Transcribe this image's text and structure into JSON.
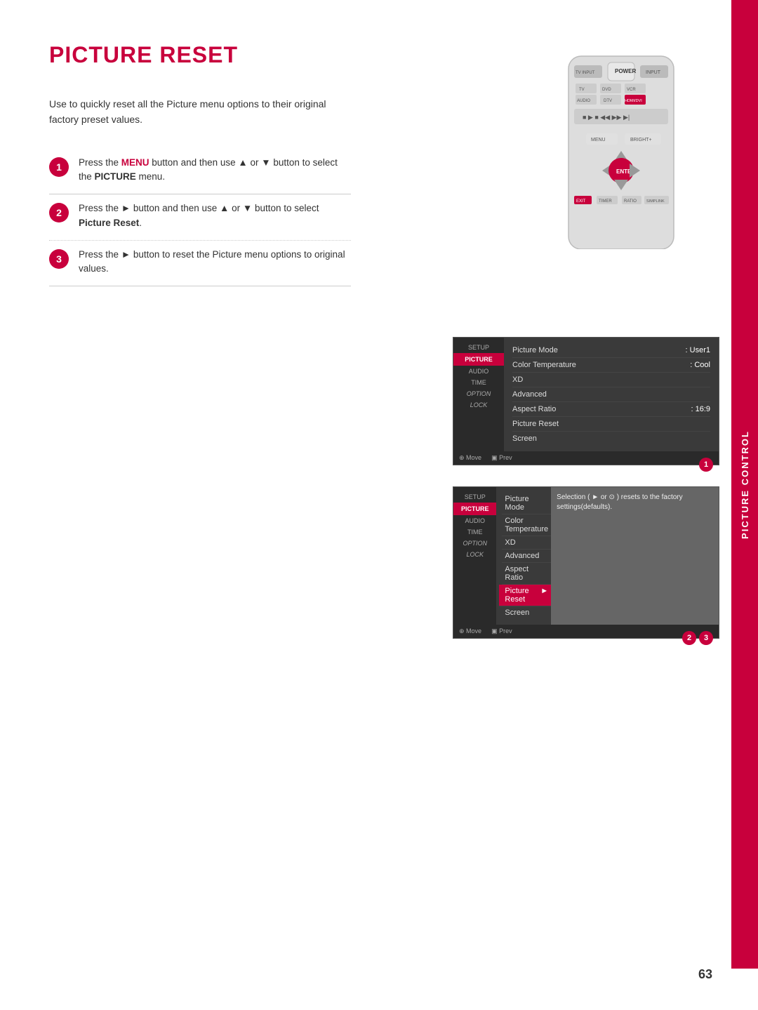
{
  "page": {
    "title": "PICTURE RESET",
    "number": "63",
    "sidebar_label": "PICTURE CONTROL"
  },
  "intro": {
    "text": "Use to quickly reset all the Picture menu options to their original factory preset values."
  },
  "steps": [
    {
      "number": "1",
      "parts": [
        {
          "text": "Press the ",
          "type": "normal"
        },
        {
          "text": "MENU",
          "type": "pink"
        },
        {
          "text": " button and then use ▲ or ▼ button to select the ",
          "type": "normal"
        },
        {
          "text": "PICTURE",
          "type": "bold"
        },
        {
          "text": " menu.",
          "type": "normal"
        }
      ]
    },
    {
      "number": "2",
      "parts": [
        {
          "text": "Press the ",
          "type": "normal"
        },
        {
          "text": "►",
          "type": "normal"
        },
        {
          "text": " button and then use ▲ or ▼ button to select ",
          "type": "normal"
        },
        {
          "text": "Picture Reset",
          "type": "bold"
        },
        {
          "text": ".",
          "type": "normal"
        }
      ]
    },
    {
      "number": "3",
      "parts": [
        {
          "text": "Press the ",
          "type": "normal"
        },
        {
          "text": "►",
          "type": "normal"
        },
        {
          "text": " button to reset the Picture menu options to original values.",
          "type": "normal"
        }
      ]
    }
  ],
  "screenshot1": {
    "menu_items": [
      {
        "label": "Picture Mode",
        "value": ": User1",
        "highlighted": false
      },
      {
        "label": "Color Temperature",
        "value": ": Cool",
        "highlighted": false
      },
      {
        "label": "XD",
        "value": "",
        "highlighted": false
      },
      {
        "label": "Advanced",
        "value": "",
        "highlighted": false
      },
      {
        "label": "Aspect Ratio",
        "value": ": 16:9",
        "highlighted": false
      },
      {
        "label": "Picture Reset",
        "value": "",
        "highlighted": false
      },
      {
        "label": "Screen",
        "value": "",
        "highlighted": false
      }
    ],
    "sidebar_items": [
      "SETUP",
      "PICTURE",
      "AUDIO",
      "TIME",
      "OPTION",
      "LOCK"
    ],
    "nav_text": "Move  Prev",
    "badge": "1"
  },
  "screenshot2": {
    "menu_items": [
      {
        "label": "Picture Mode",
        "value": "",
        "highlighted": false
      },
      {
        "label": "Color Temperature",
        "value": "",
        "highlighted": false
      },
      {
        "label": "XD",
        "value": "",
        "highlighted": false
      },
      {
        "label": "Advanced",
        "value": "",
        "highlighted": false
      },
      {
        "label": "Aspect Ratio",
        "value": "",
        "highlighted": false
      },
      {
        "label": "Picture Reset",
        "value": "►",
        "highlighted": true
      },
      {
        "label": "Screen",
        "value": "",
        "highlighted": false
      }
    ],
    "sidebar_items": [
      "SETUP",
      "PICTURE",
      "AUDIO",
      "TIME",
      "OPTION",
      "LOCK"
    ],
    "sub_panel": "Selection ( ► or ⊙ ) resets to the factory settings(defaults).",
    "nav_text": "Move  Prev",
    "badges": [
      "2",
      "3"
    ]
  }
}
